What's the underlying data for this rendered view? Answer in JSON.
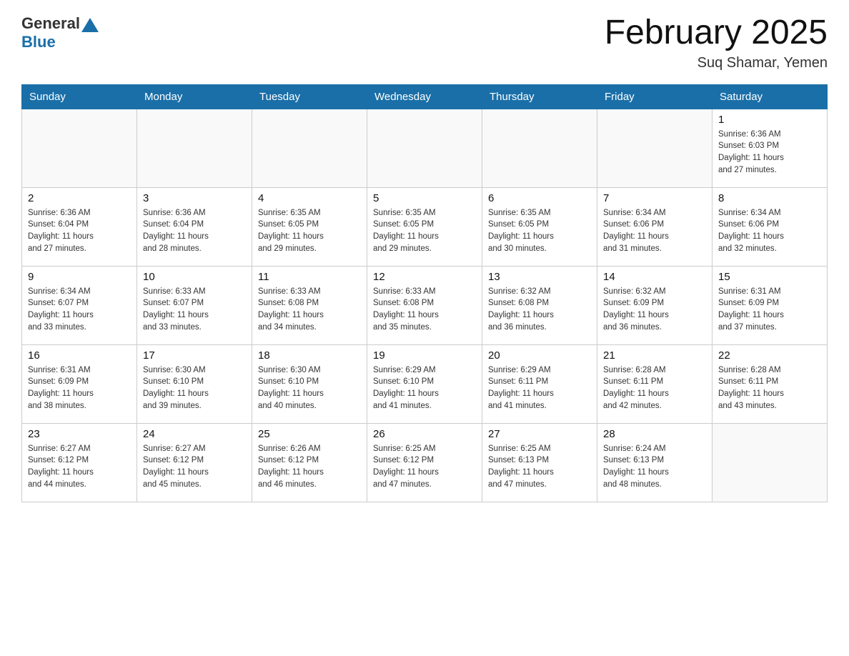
{
  "header": {
    "logo_general": "General",
    "logo_blue": "Blue",
    "title": "February 2025",
    "subtitle": "Suq Shamar, Yemen"
  },
  "weekdays": [
    "Sunday",
    "Monday",
    "Tuesday",
    "Wednesday",
    "Thursday",
    "Friday",
    "Saturday"
  ],
  "weeks": [
    [
      {
        "day": "",
        "info": ""
      },
      {
        "day": "",
        "info": ""
      },
      {
        "day": "",
        "info": ""
      },
      {
        "day": "",
        "info": ""
      },
      {
        "day": "",
        "info": ""
      },
      {
        "day": "",
        "info": ""
      },
      {
        "day": "1",
        "info": "Sunrise: 6:36 AM\nSunset: 6:03 PM\nDaylight: 11 hours\nand 27 minutes."
      }
    ],
    [
      {
        "day": "2",
        "info": "Sunrise: 6:36 AM\nSunset: 6:04 PM\nDaylight: 11 hours\nand 27 minutes."
      },
      {
        "day": "3",
        "info": "Sunrise: 6:36 AM\nSunset: 6:04 PM\nDaylight: 11 hours\nand 28 minutes."
      },
      {
        "day": "4",
        "info": "Sunrise: 6:35 AM\nSunset: 6:05 PM\nDaylight: 11 hours\nand 29 minutes."
      },
      {
        "day": "5",
        "info": "Sunrise: 6:35 AM\nSunset: 6:05 PM\nDaylight: 11 hours\nand 29 minutes."
      },
      {
        "day": "6",
        "info": "Sunrise: 6:35 AM\nSunset: 6:05 PM\nDaylight: 11 hours\nand 30 minutes."
      },
      {
        "day": "7",
        "info": "Sunrise: 6:34 AM\nSunset: 6:06 PM\nDaylight: 11 hours\nand 31 minutes."
      },
      {
        "day": "8",
        "info": "Sunrise: 6:34 AM\nSunset: 6:06 PM\nDaylight: 11 hours\nand 32 minutes."
      }
    ],
    [
      {
        "day": "9",
        "info": "Sunrise: 6:34 AM\nSunset: 6:07 PM\nDaylight: 11 hours\nand 33 minutes."
      },
      {
        "day": "10",
        "info": "Sunrise: 6:33 AM\nSunset: 6:07 PM\nDaylight: 11 hours\nand 33 minutes."
      },
      {
        "day": "11",
        "info": "Sunrise: 6:33 AM\nSunset: 6:08 PM\nDaylight: 11 hours\nand 34 minutes."
      },
      {
        "day": "12",
        "info": "Sunrise: 6:33 AM\nSunset: 6:08 PM\nDaylight: 11 hours\nand 35 minutes."
      },
      {
        "day": "13",
        "info": "Sunrise: 6:32 AM\nSunset: 6:08 PM\nDaylight: 11 hours\nand 36 minutes."
      },
      {
        "day": "14",
        "info": "Sunrise: 6:32 AM\nSunset: 6:09 PM\nDaylight: 11 hours\nand 36 minutes."
      },
      {
        "day": "15",
        "info": "Sunrise: 6:31 AM\nSunset: 6:09 PM\nDaylight: 11 hours\nand 37 minutes."
      }
    ],
    [
      {
        "day": "16",
        "info": "Sunrise: 6:31 AM\nSunset: 6:09 PM\nDaylight: 11 hours\nand 38 minutes."
      },
      {
        "day": "17",
        "info": "Sunrise: 6:30 AM\nSunset: 6:10 PM\nDaylight: 11 hours\nand 39 minutes."
      },
      {
        "day": "18",
        "info": "Sunrise: 6:30 AM\nSunset: 6:10 PM\nDaylight: 11 hours\nand 40 minutes."
      },
      {
        "day": "19",
        "info": "Sunrise: 6:29 AM\nSunset: 6:10 PM\nDaylight: 11 hours\nand 41 minutes."
      },
      {
        "day": "20",
        "info": "Sunrise: 6:29 AM\nSunset: 6:11 PM\nDaylight: 11 hours\nand 41 minutes."
      },
      {
        "day": "21",
        "info": "Sunrise: 6:28 AM\nSunset: 6:11 PM\nDaylight: 11 hours\nand 42 minutes."
      },
      {
        "day": "22",
        "info": "Sunrise: 6:28 AM\nSunset: 6:11 PM\nDaylight: 11 hours\nand 43 minutes."
      }
    ],
    [
      {
        "day": "23",
        "info": "Sunrise: 6:27 AM\nSunset: 6:12 PM\nDaylight: 11 hours\nand 44 minutes."
      },
      {
        "day": "24",
        "info": "Sunrise: 6:27 AM\nSunset: 6:12 PM\nDaylight: 11 hours\nand 45 minutes."
      },
      {
        "day": "25",
        "info": "Sunrise: 6:26 AM\nSunset: 6:12 PM\nDaylight: 11 hours\nand 46 minutes."
      },
      {
        "day": "26",
        "info": "Sunrise: 6:25 AM\nSunset: 6:12 PM\nDaylight: 11 hours\nand 47 minutes."
      },
      {
        "day": "27",
        "info": "Sunrise: 6:25 AM\nSunset: 6:13 PM\nDaylight: 11 hours\nand 47 minutes."
      },
      {
        "day": "28",
        "info": "Sunrise: 6:24 AM\nSunset: 6:13 PM\nDaylight: 11 hours\nand 48 minutes."
      },
      {
        "day": "",
        "info": ""
      }
    ]
  ]
}
